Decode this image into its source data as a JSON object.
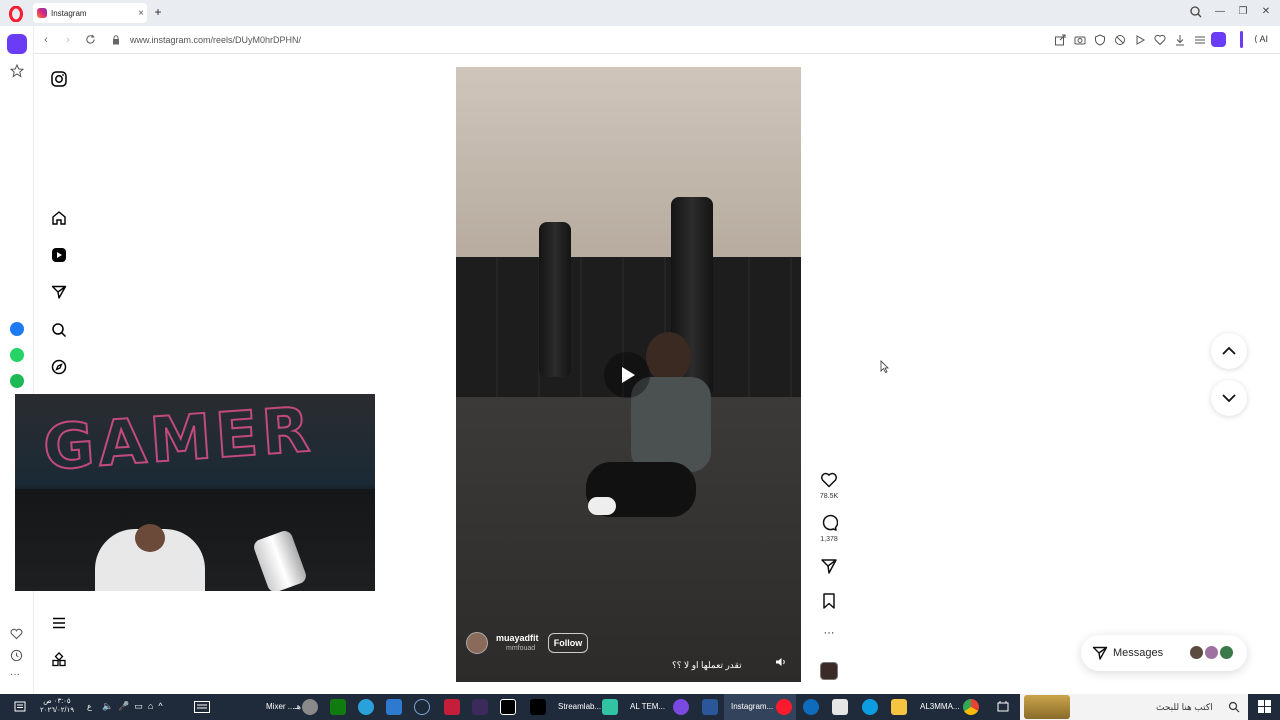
{
  "browser": {
    "tab_title": "Instagram",
    "url": "www.instagram.com/reels/DUyM0hrDPHN/",
    "ai_label": "AI"
  },
  "reel": {
    "username": "muayadfit",
    "subtitle": "mmfouad",
    "follow_label": "Follow",
    "caption": "تقدر تعملها او لا ؟؟"
  },
  "actions": {
    "likes": "78.5K",
    "comments": "1,378"
  },
  "messages": {
    "label": "Messages"
  },
  "taskbar": {
    "time": "٠٣:٠٥ ص",
    "date": "٢٠٢٦/٠٢/١٩",
    "lang": "ع",
    "mixer": "Mixer ...هـ",
    "streamlab": "Streamlab...",
    "altem": "AL TEM...",
    "instagram": "Instagram...",
    "al3mma": "AL3MMA...",
    "search_placeholder": "اكتب هنا للبحث"
  },
  "colors": {
    "opera_red": "#ff1b2d",
    "opera_purple": "#6b3cf6",
    "taskbar": "#1f2a3a"
  }
}
